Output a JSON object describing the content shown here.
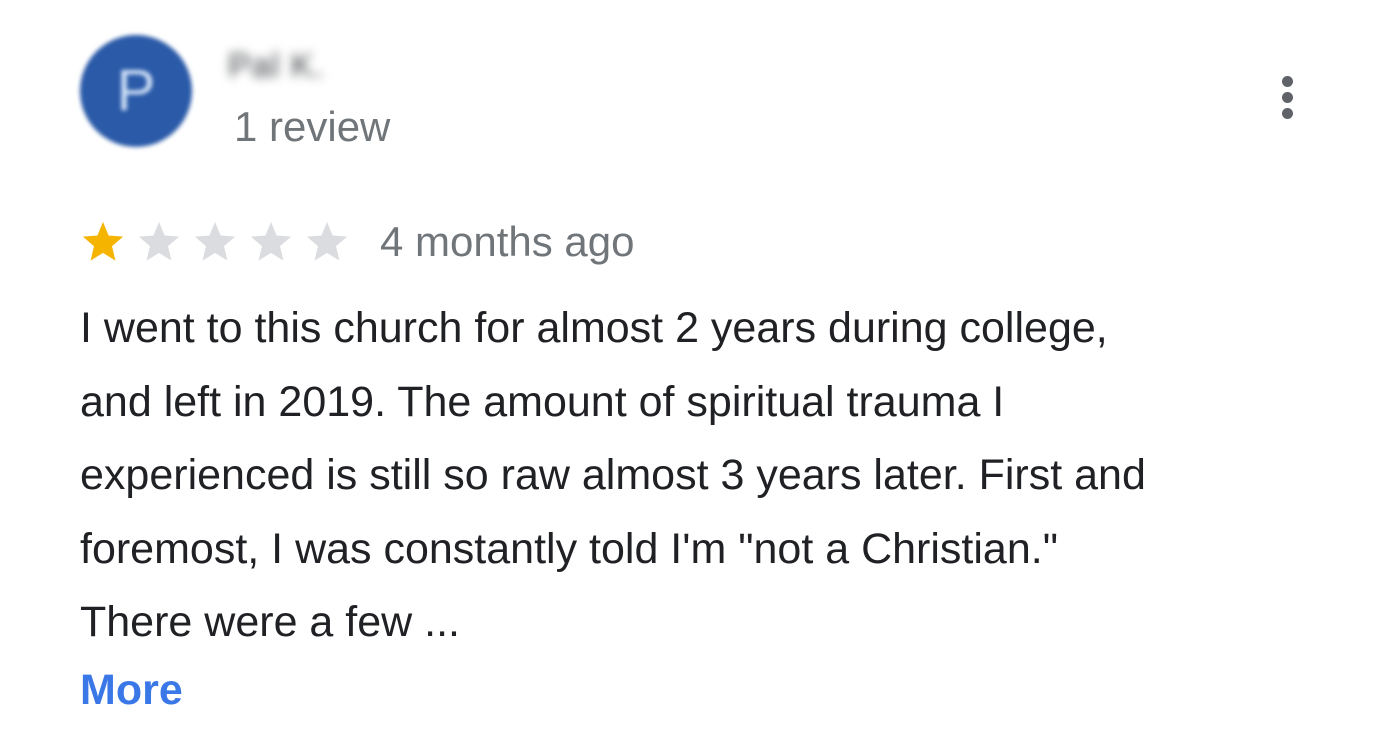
{
  "reviewer": {
    "avatar_letter": "P",
    "name": "Pal K.",
    "review_count": "1 review"
  },
  "menu": {
    "icon": "more-vert-icon"
  },
  "rating": {
    "stars": 1,
    "max_stars": 5,
    "filled_color": "#f4b400",
    "empty_color": "#dadce0",
    "timestamp": "4 months ago"
  },
  "review": {
    "text": "I went to this church for almost 2 years during college,\nand left in 2019. The amount of spiritual trauma I\nexperienced is still so raw almost 3 years later. First and\nforemost, I was constantly told I'm \"not a Christian.\"\nThere were a few ...",
    "more_label": "More"
  },
  "colors": {
    "avatar_bg": "#2a5aa8",
    "link": "#3b78e7"
  }
}
